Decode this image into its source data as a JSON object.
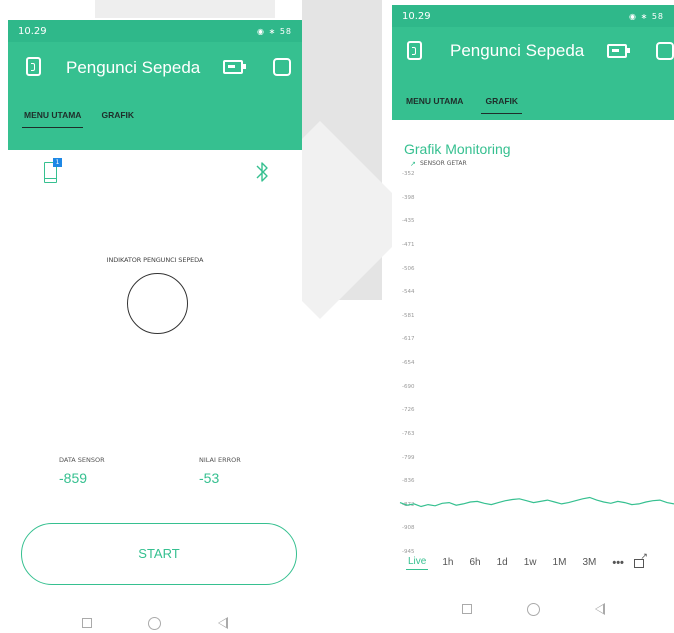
{
  "left_screen": {
    "status": {
      "time": "10.29",
      "indicators": "◉ ∗ 58"
    },
    "app_title": "Pengunci Sepeda",
    "tabs": [
      {
        "label": "MENU UTAMA",
        "active": true
      },
      {
        "label": "GRAFIK",
        "active": false
      }
    ],
    "phone_badge": "1",
    "indicator_label": "INDIKATOR PENGUNCI SEPEDA",
    "data_sensor": {
      "label": "DATA SENSOR",
      "value": "-859"
    },
    "nilai_error": {
      "label": "NILAI ERROR",
      "value": "-53"
    },
    "start_label": "START"
  },
  "right_screen": {
    "status": {
      "time": "10.29",
      "indicators": "◉ ∗ 58"
    },
    "app_title": "Pengunci Sepeda",
    "tabs": [
      {
        "label": "MENU UTAMA",
        "active": false
      },
      {
        "label": "GRAFIK",
        "active": true
      }
    ],
    "graph_title": "Grafik Monitoring",
    "time_ranges": [
      "Live",
      "1h",
      "6h",
      "1d",
      "1w",
      "1M",
      "3M"
    ],
    "more_label": "•••"
  },
  "colors": {
    "accent": "#36c090",
    "status_bar": "#2fb88a"
  },
  "chart_data": {
    "type": "line",
    "title": "Grafik Monitoring",
    "series": [
      {
        "name": "SENSOR GETAR",
        "values": [
          -866,
          -870,
          -868,
          -872,
          -869,
          -871,
          -867,
          -866,
          -870,
          -868,
          -865,
          -864,
          -867,
          -869,
          -866,
          -863,
          -861,
          -860,
          -863,
          -866,
          -864,
          -862,
          -865,
          -868,
          -866,
          -863,
          -860,
          -858,
          -862,
          -865,
          -867,
          -864,
          -866,
          -869,
          -868,
          -865,
          -863,
          -862,
          -866,
          -868
        ]
      }
    ],
    "y_ticks": [
      "-352",
      "-398",
      "-435",
      "-471",
      "-506",
      "-544",
      "-581",
      "-617",
      "-654",
      "-690",
      "-726",
      "-763",
      "-799",
      "-836",
      "-872",
      "-908",
      "-945"
    ],
    "ylim": [
      -945,
      -352
    ],
    "grid": false,
    "legend_position": "top-left"
  }
}
